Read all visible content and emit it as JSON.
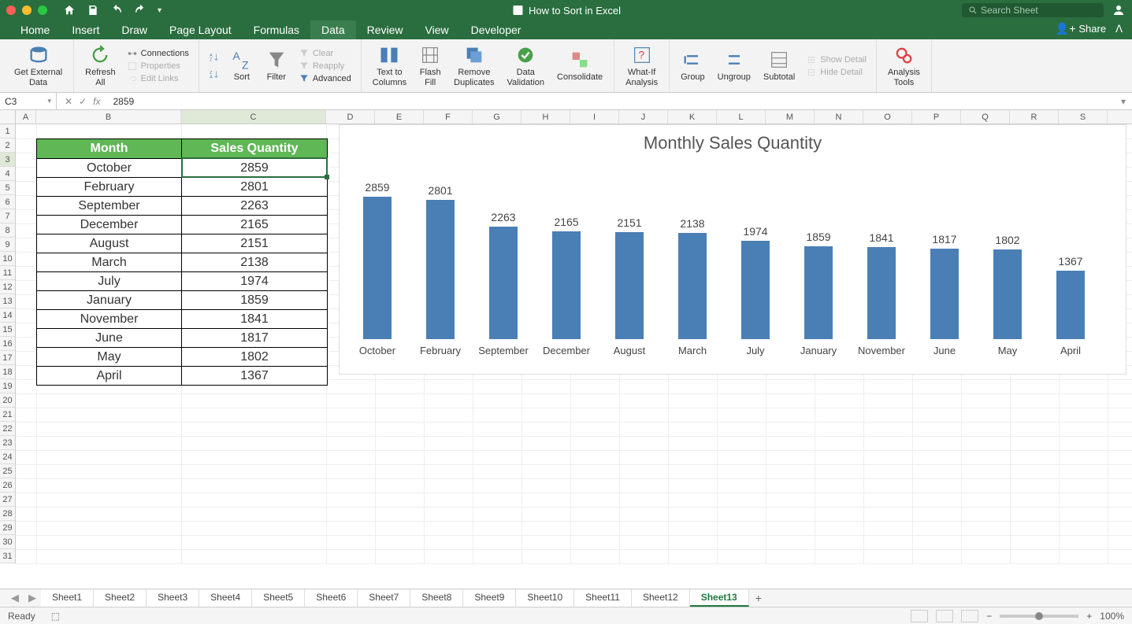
{
  "title": "How to Sort in Excel",
  "search_placeholder": "Search Sheet",
  "share_label": "Share",
  "tabs": [
    "Home",
    "Insert",
    "Draw",
    "Page Layout",
    "Formulas",
    "Data",
    "Review",
    "View",
    "Developer"
  ],
  "active_tab": "Data",
  "ribbon": {
    "get_external_data": "Get External\nData",
    "refresh_all": "Refresh\nAll",
    "connections": "Connections",
    "properties": "Properties",
    "edit_links": "Edit Links",
    "sort": "Sort",
    "filter": "Filter",
    "clear": "Clear",
    "reapply": "Reapply",
    "advanced": "Advanced",
    "text_to_columns": "Text to\nColumns",
    "flash_fill": "Flash\nFill",
    "remove_duplicates": "Remove\nDuplicates",
    "data_validation": "Data\nValidation",
    "consolidate": "Consolidate",
    "what_if": "What-If\nAnalysis",
    "group": "Group",
    "ungroup": "Ungroup",
    "subtotal": "Subtotal",
    "show_detail": "Show Detail",
    "hide_detail": "Hide Detail",
    "analysis_tools": "Analysis\nTools"
  },
  "namebox": "C3",
  "formula": "2859",
  "cols": [
    "A",
    "B",
    "C",
    "D",
    "E",
    "F",
    "G",
    "H",
    "I",
    "J",
    "K",
    "L",
    "M",
    "N",
    "O",
    "P",
    "Q",
    "R",
    "S"
  ],
  "table": {
    "h1": "Month",
    "h2": "Sales Quantity",
    "rows": [
      {
        "m": "October",
        "v": "2859"
      },
      {
        "m": "February",
        "v": "2801"
      },
      {
        "m": "September",
        "v": "2263"
      },
      {
        "m": "December",
        "v": "2165"
      },
      {
        "m": "August",
        "v": "2151"
      },
      {
        "m": "March",
        "v": "2138"
      },
      {
        "m": "July",
        "v": "1974"
      },
      {
        "m": "January",
        "v": "1859"
      },
      {
        "m": "November",
        "v": "1841"
      },
      {
        "m": "June",
        "v": "1817"
      },
      {
        "m": "May",
        "v": "1802"
      },
      {
        "m": "April",
        "v": "1367"
      }
    ]
  },
  "chart_data": {
    "type": "bar",
    "title": "Monthly Sales Quantity",
    "categories": [
      "October",
      "February",
      "September",
      "December",
      "August",
      "March",
      "July",
      "January",
      "November",
      "June",
      "May",
      "April"
    ],
    "values": [
      2859,
      2801,
      2263,
      2165,
      2151,
      2138,
      1974,
      1859,
      1841,
      1817,
      1802,
      1367
    ],
    "ylim": [
      0,
      3000
    ]
  },
  "sheets": [
    "Sheet1",
    "Sheet2",
    "Sheet3",
    "Sheet4",
    "Sheet5",
    "Sheet6",
    "Sheet7",
    "Sheet8",
    "Sheet9",
    "Sheet10",
    "Sheet11",
    "Sheet12",
    "Sheet13"
  ],
  "active_sheet": "Sheet13",
  "status": "Ready",
  "zoom": "100%"
}
